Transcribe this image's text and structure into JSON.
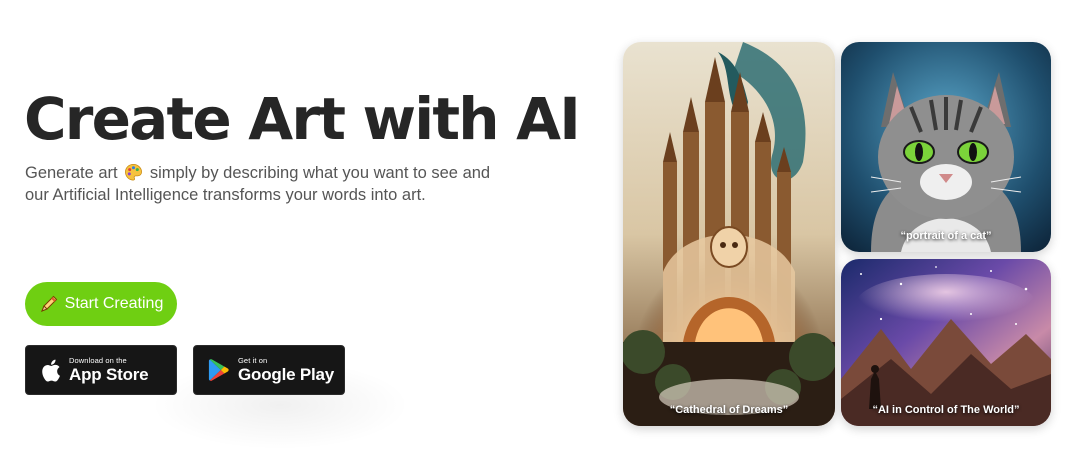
{
  "hero": {
    "title": "Create Art with AI",
    "subtitle_before": "Generate art",
    "subtitle_after": "simply by describing what you want to see and our Artificial Intelligence transforms your words into art.",
    "emoji_icon": "artist-palette"
  },
  "cta": {
    "start_label": "Start Creating",
    "start_icon": "pencil-icon",
    "accent": "#6fcf12"
  },
  "stores": {
    "apple": {
      "small": "Download on the",
      "big": "App Store",
      "icon": "apple-icon"
    },
    "google": {
      "small": "Get it on",
      "big": "Google Play",
      "icon": "google-play-icon"
    }
  },
  "gallery": {
    "cathedral_caption": "“Cathedral of Dreams”",
    "cat_caption": "“portrait of a cat”",
    "world_caption": "“AI in Control of The World”"
  }
}
